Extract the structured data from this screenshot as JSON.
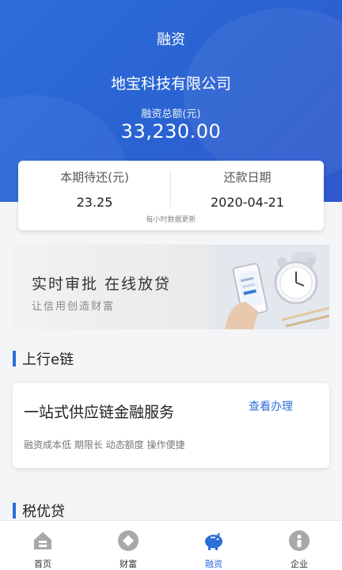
{
  "header": {
    "title": "融资",
    "company": "地宝科技有限公司",
    "total_label": "融资总额(元)",
    "total_value": "33,230.00"
  },
  "repayment": {
    "due_label": "本期待还(元)",
    "due_value": "23.25",
    "date_label": "还款日期",
    "date_value": "2020-04-21",
    "note": "每小时数据更新"
  },
  "banner": {
    "title": "实时审批 在线放贷",
    "subtitle": "让信用创造财富"
  },
  "sections": [
    {
      "title": "上行e链"
    },
    {
      "title": "税优贷"
    }
  ],
  "product": {
    "title": "一站式供应链金融服务",
    "action": "查看办理",
    "desc": "融资成本低 期限长 动态额度 操作便捷"
  },
  "tabbar": {
    "active": "融资",
    "items": [
      {
        "label": "首页",
        "icon": "home-icon"
      },
      {
        "label": "财富",
        "icon": "diamond-icon"
      },
      {
        "label": "融资",
        "icon": "piggy-bank-icon"
      },
      {
        "label": "企业",
        "icon": "enterprise-icon"
      }
    ]
  },
  "colors": {
    "primary": "#2d6ed9",
    "inactive_icon": "#a8a8a8"
  }
}
